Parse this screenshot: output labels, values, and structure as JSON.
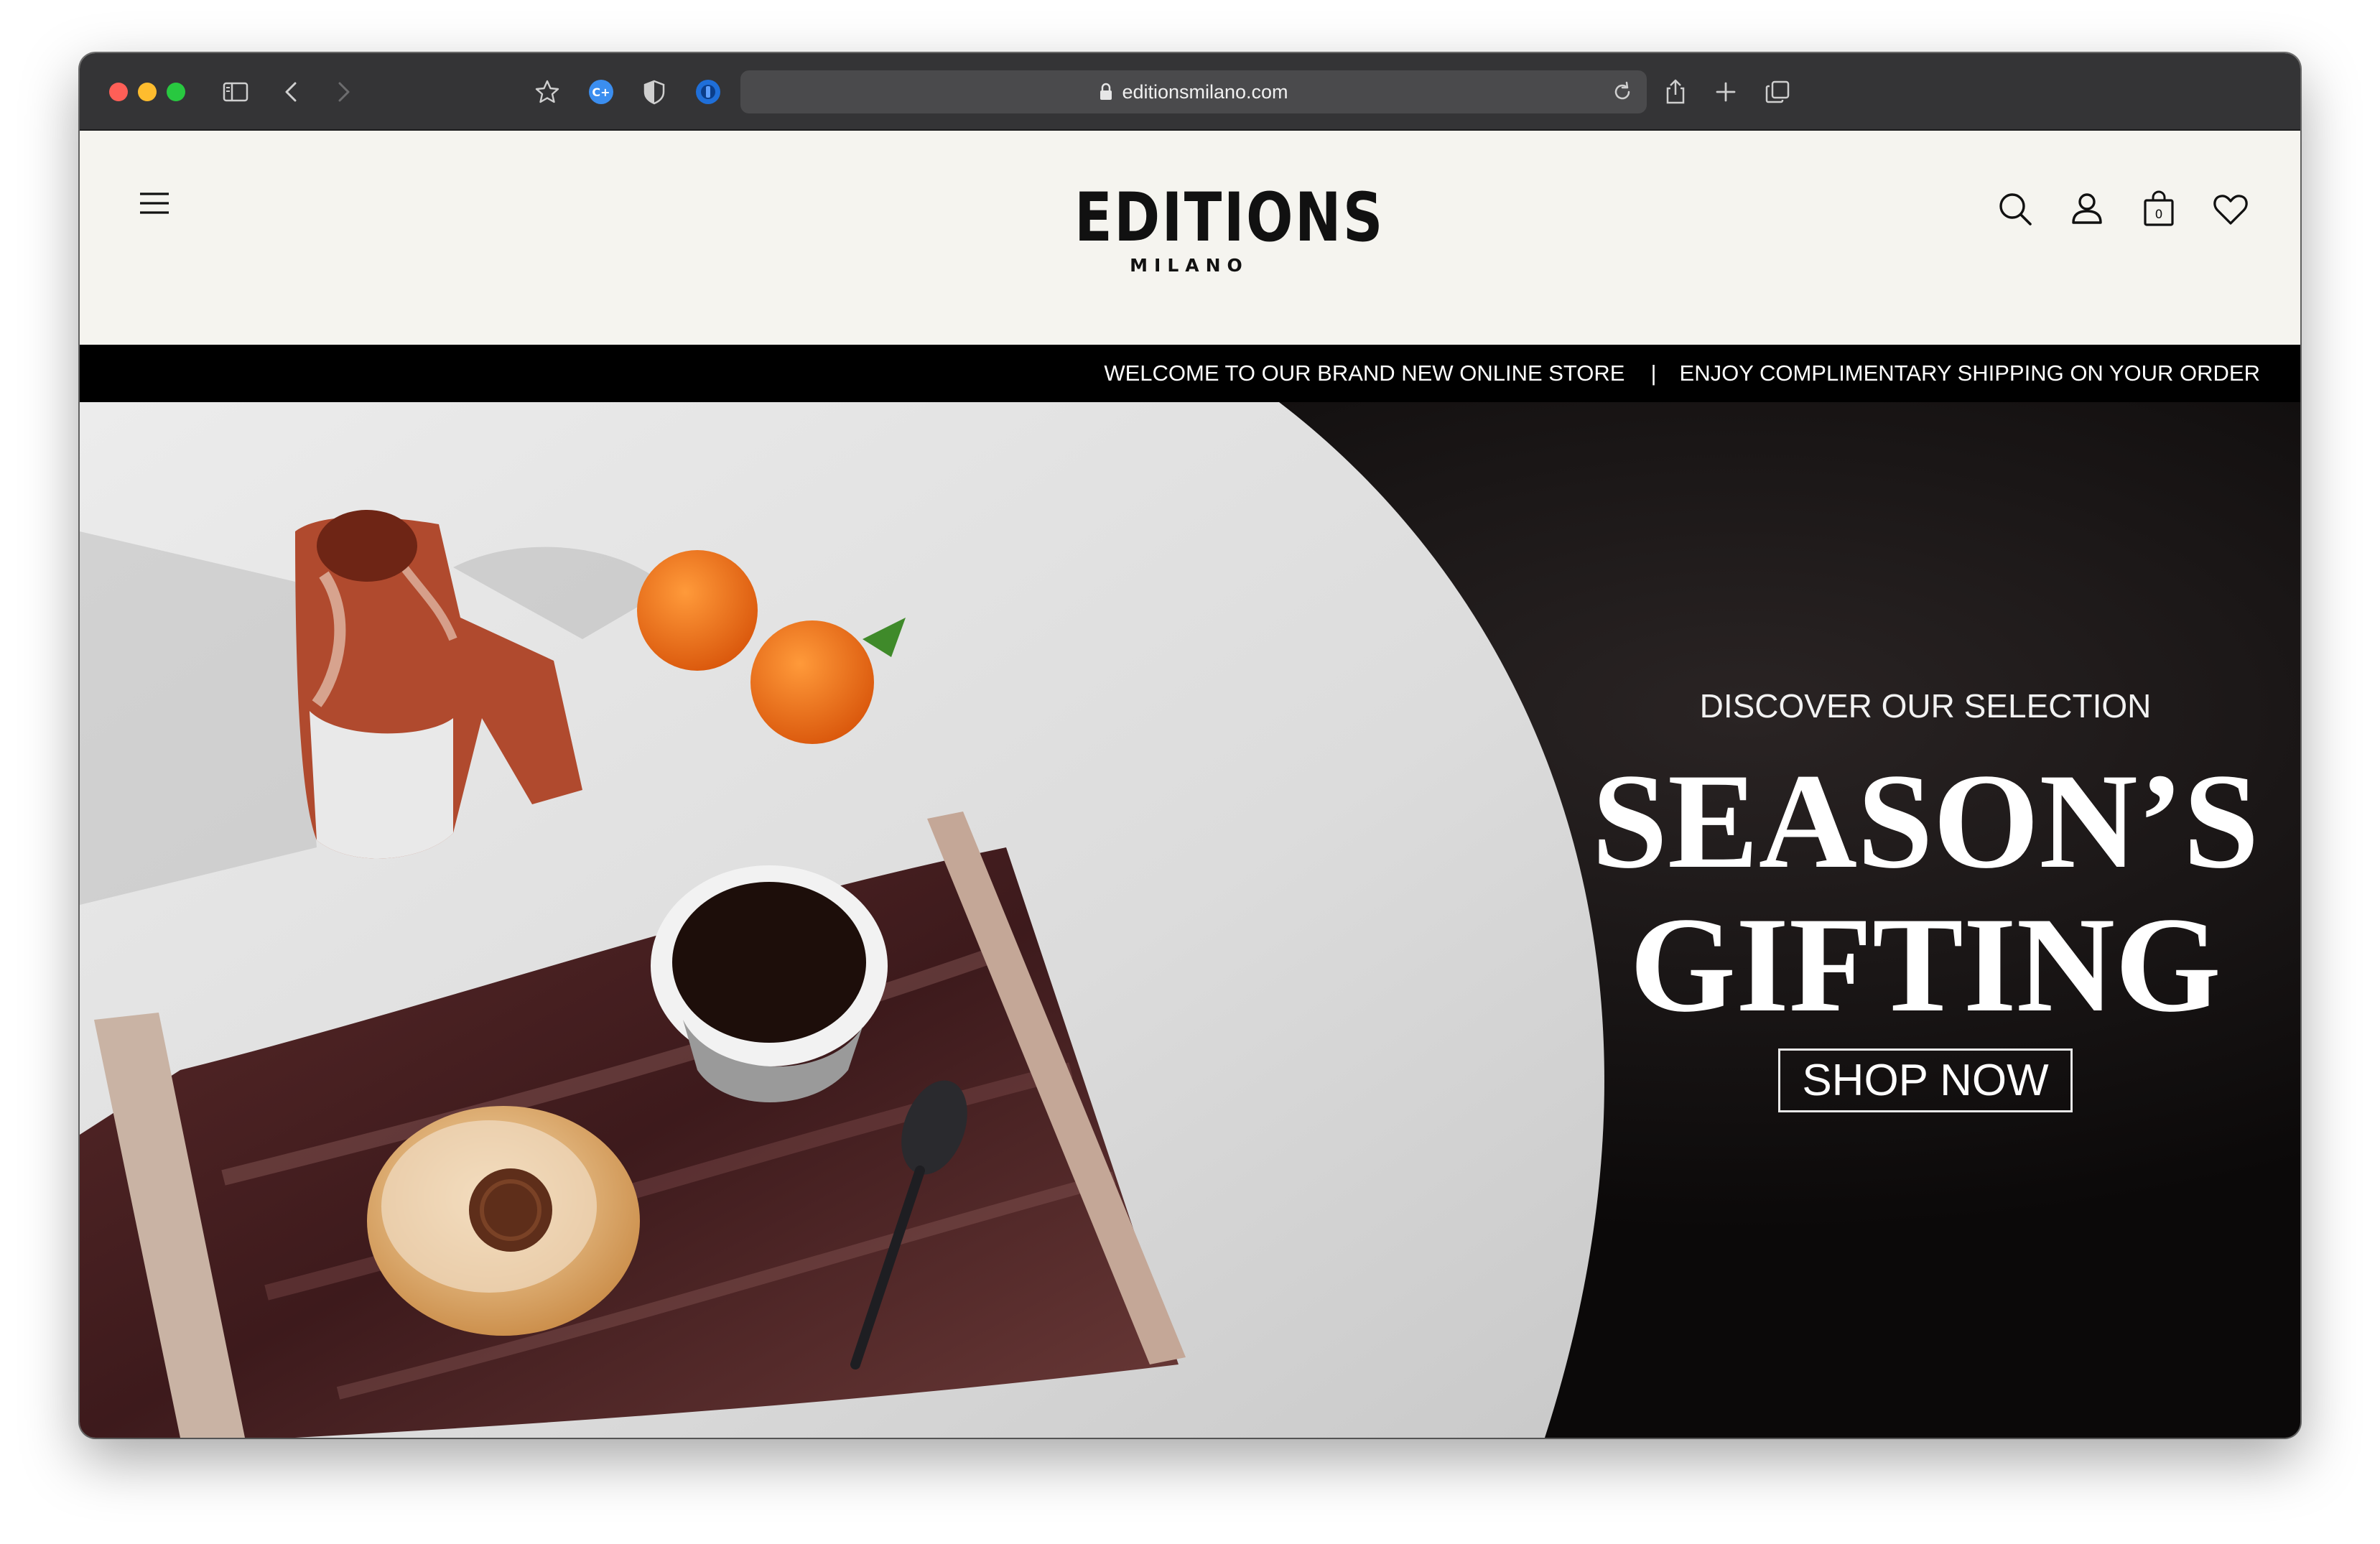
{
  "browser": {
    "url": "editionsmilano.com",
    "icons": [
      "sidebar-icon",
      "back-icon",
      "forward-icon",
      "star-icon",
      "extension-c-icon",
      "shield-icon",
      "extension-blue-icon",
      "reload-icon",
      "share-icon",
      "new-tab-icon",
      "tabs-overview-icon"
    ]
  },
  "header": {
    "logo_main": "EDITIONS",
    "logo_sub": "MILANO",
    "cart_count": "0",
    "icons": [
      "menu-icon",
      "search-icon",
      "account-icon",
      "cart-icon",
      "wishlist-icon"
    ]
  },
  "announcement": {
    "left": "WELCOME TO OUR BRAND NEW ONLINE STORE",
    "separator": "|",
    "right": "ENJOY COMPLIMENTARY SHIPPING ON YOUR ORDER"
  },
  "hero": {
    "eyebrow": "DISCOVER OUR SELECTION",
    "title_line1": "SEASON’S",
    "title_line2": "GIFTING",
    "cta": "SHOP NOW"
  },
  "colors": {
    "toolbar": "#343436",
    "header_bg": "#f5f4ef",
    "announce_bg": "#000000",
    "hero_dark": "#0e0b0b",
    "table_white": "#e4e4e4"
  }
}
